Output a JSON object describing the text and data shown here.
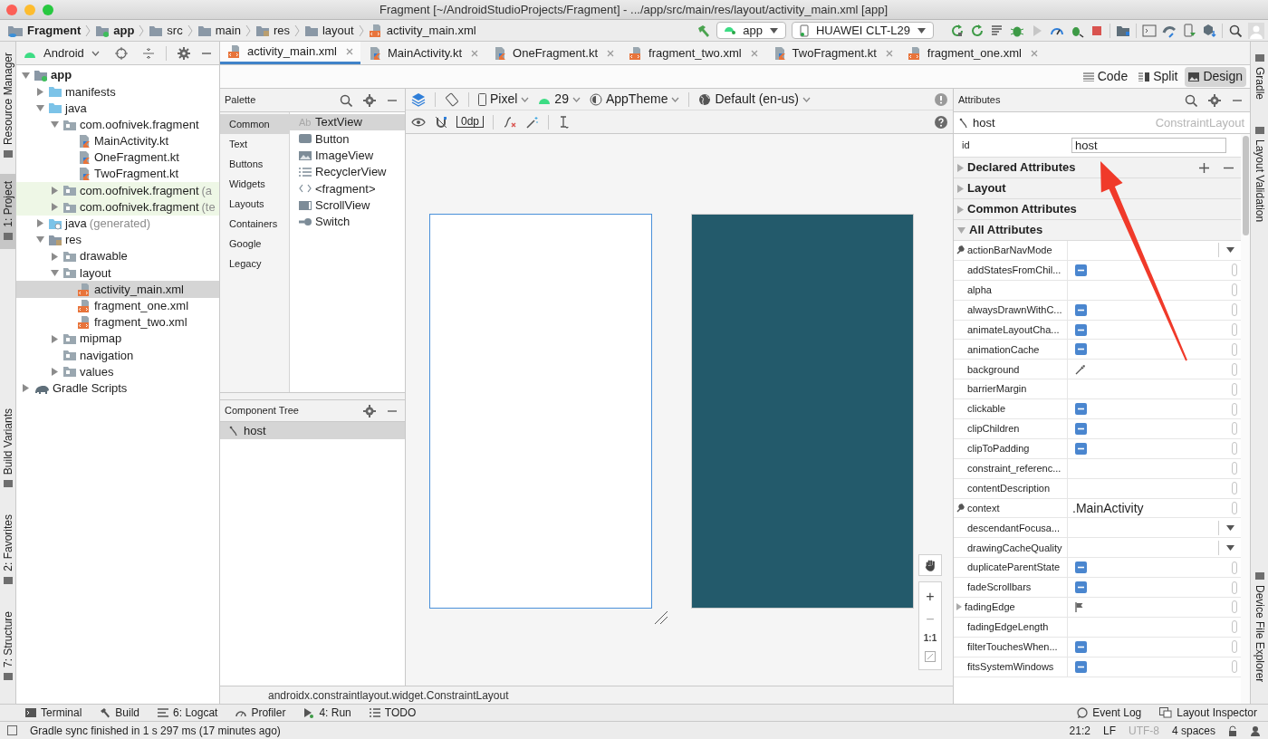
{
  "window": {
    "title": "Fragment [~/AndroidStudioProjects/Fragment] - .../app/src/main/res/layout/activity_main.xml [app]"
  },
  "breadcrumbs": [
    {
      "label": "Fragment",
      "kind": "project"
    },
    {
      "label": "app",
      "kind": "module"
    },
    {
      "label": "src",
      "kind": "folder"
    },
    {
      "label": "main",
      "kind": "folder"
    },
    {
      "label": "res",
      "kind": "res"
    },
    {
      "label": "layout",
      "kind": "folder"
    },
    {
      "label": "activity_main.xml",
      "kind": "xml"
    }
  ],
  "run_config": "app",
  "device": "HUAWEI CLT-L29",
  "left_tool_tabs_top": [
    {
      "label": "Resource Manager",
      "selected": false
    },
    {
      "label": "1: Project",
      "selected": true
    }
  ],
  "left_tool_tabs_bottom": [
    {
      "label": "Build Variants",
      "selected": false
    },
    {
      "label": "2: Favorites",
      "selected": false
    },
    {
      "label": "7: Structure",
      "selected": false
    }
  ],
  "right_tool_tabs_top": [
    {
      "label": "Gradle",
      "selected": false
    },
    {
      "label": "Layout Validation",
      "selected": false
    }
  ],
  "right_tool_tabs_bottom": [
    {
      "label": "Device File Explorer",
      "selected": false
    }
  ],
  "project_view": "Android",
  "project_tree": [
    {
      "label": "app",
      "kind": "module",
      "bold": true,
      "selected": false,
      "expanded": true,
      "children": [
        {
          "label": "manifests",
          "kind": "source-folder",
          "selected": false,
          "expanded": false
        },
        {
          "label": "java",
          "kind": "source-folder",
          "selected": false,
          "expanded": true,
          "children": [
            {
              "label": "com.oofnivek.fragment",
              "kind": "package",
              "selected": false,
              "expanded": true,
              "children": [
                {
                  "label": "MainActivity.kt",
                  "kind": "kotlin",
                  "selected": false
                },
                {
                  "label": "OneFragment.kt",
                  "kind": "kotlin",
                  "selected": false
                },
                {
                  "label": "TwoFragment.kt",
                  "kind": "kotlin",
                  "selected": false
                }
              ]
            },
            {
              "label": "com.oofnivek.fragment",
              "suffix": "(a",
              "kind": "test-package",
              "selected": false,
              "expanded": false
            },
            {
              "label": "com.oofnivek.fragment",
              "suffix": "(te",
              "kind": "test-package",
              "selected": false,
              "expanded": false
            }
          ]
        },
        {
          "label": "java",
          "suffix": "(generated)",
          "kind": "generated-folder",
          "selected": false,
          "expanded": false
        },
        {
          "label": "res",
          "kind": "res",
          "selected": false,
          "expanded": true,
          "children": [
            {
              "label": "drawable",
              "kind": "package",
              "selected": false,
              "expanded": false
            },
            {
              "label": "layout",
              "kind": "package",
              "selected": false,
              "expanded": true,
              "children": [
                {
                  "label": "activity_main.xml",
                  "kind": "xml",
                  "selected": true
                },
                {
                  "label": "fragment_one.xml",
                  "kind": "xml",
                  "selected": false
                },
                {
                  "label": "fragment_two.xml",
                  "kind": "xml",
                  "selected": false
                }
              ]
            },
            {
              "label": "mipmap",
              "kind": "package",
              "selected": false,
              "expanded": false
            },
            {
              "label": "navigation",
              "kind": "package",
              "selected": false
            },
            {
              "label": "values",
              "kind": "package",
              "selected": false,
              "expanded": false
            }
          ]
        }
      ]
    },
    {
      "label": "Gradle Scripts",
      "kind": "gradle",
      "bold": false,
      "selected": false,
      "expanded": false
    }
  ],
  "editor_tabs": [
    {
      "label": "activity_main.xml",
      "kind": "xml",
      "selected": true
    },
    {
      "label": "MainActivity.kt",
      "kind": "kotlin",
      "selected": false
    },
    {
      "label": "OneFragment.kt",
      "kind": "kotlin",
      "selected": false
    },
    {
      "label": "fragment_two.xml",
      "kind": "xml",
      "selected": false
    },
    {
      "label": "TwoFragment.kt",
      "kind": "kotlin",
      "selected": false
    },
    {
      "label": "fragment_one.xml",
      "kind": "xml",
      "selected": false
    }
  ],
  "view_modes": [
    {
      "label": "Code",
      "kind": "code",
      "selected": false
    },
    {
      "label": "Split",
      "kind": "split",
      "selected": false
    },
    {
      "label": "Design",
      "kind": "design",
      "selected": true
    }
  ],
  "palette": {
    "title": "Palette",
    "categories": [
      {
        "label": "Common",
        "selected": true
      },
      {
        "label": "Text",
        "selected": false
      },
      {
        "label": "Buttons",
        "selected": false
      },
      {
        "label": "Widgets",
        "selected": false
      },
      {
        "label": "Layouts",
        "selected": false
      },
      {
        "label": "Containers",
        "selected": false
      },
      {
        "label": "Google",
        "selected": false
      },
      {
        "label": "Legacy",
        "selected": false
      }
    ],
    "items": [
      {
        "label": "TextView",
        "kind": "text",
        "glyph": "Ab",
        "selected": true
      },
      {
        "label": "Button",
        "kind": "button",
        "selected": false
      },
      {
        "label": "ImageView",
        "kind": "image",
        "selected": false
      },
      {
        "label": "RecyclerView",
        "kind": "list",
        "selected": false
      },
      {
        "label": "<fragment>",
        "kind": "fragment",
        "selected": false
      },
      {
        "label": "ScrollView",
        "kind": "scroll",
        "selected": false
      },
      {
        "label": "Switch",
        "kind": "switch",
        "selected": false
      }
    ]
  },
  "component_tree": {
    "title": "Component Tree",
    "items": [
      {
        "label": "host",
        "selected": true
      }
    ]
  },
  "design_toolbar": {
    "device": "Pixel",
    "api": "29",
    "theme": "AppTheme",
    "locale": "Default (en-us)",
    "margin": "0dp"
  },
  "surfaces": [
    {
      "kind": "design",
      "selected": true
    },
    {
      "kind": "blueprint",
      "selected": false
    }
  ],
  "zoom_controls": {
    "zoom_in": "+",
    "zoom_out": "−",
    "actual_size": "1:1"
  },
  "breadcrumb_path": "androidx.constraintlayout.widget.ConstraintLayout",
  "attributes": {
    "title": "Attributes",
    "component": "host",
    "component_class": "ConstraintLayout",
    "id_label": "id",
    "id_value": "host",
    "sections": [
      {
        "label": "Declared Attributes",
        "expanded": false
      },
      {
        "label": "Layout",
        "expanded": false
      },
      {
        "label": "Common Attributes",
        "expanded": false
      },
      {
        "label": "All Attributes",
        "expanded": true
      }
    ],
    "rows": [
      {
        "name": "actionBarNavMode",
        "kind": "dropdown",
        "tools": true
      },
      {
        "name": "addStatesFromChil...",
        "kind": "boolean",
        "tools": false
      },
      {
        "name": "alpha",
        "kind": "text",
        "tools": false
      },
      {
        "name": "alwaysDrawnWithC...",
        "kind": "boolean",
        "tools": false
      },
      {
        "name": "animateLayoutCha...",
        "kind": "boolean",
        "tools": false
      },
      {
        "name": "animationCache",
        "kind": "boolean",
        "tools": false
      },
      {
        "name": "background",
        "kind": "color",
        "tools": false
      },
      {
        "name": "barrierMargin",
        "kind": "text",
        "tools": false
      },
      {
        "name": "clickable",
        "kind": "boolean",
        "tools": false
      },
      {
        "name": "clipChildren",
        "kind": "boolean",
        "tools": false
      },
      {
        "name": "clipToPadding",
        "kind": "boolean",
        "tools": false
      },
      {
        "name": "constraint_referenc...",
        "kind": "text",
        "tools": false
      },
      {
        "name": "contentDescription",
        "kind": "text",
        "tools": false
      },
      {
        "name": "context",
        "kind": "text",
        "tools": true,
        "value": ".MainActivity"
      },
      {
        "name": "descendantFocusa...",
        "kind": "dropdown",
        "tools": false
      },
      {
        "name": "drawingCacheQuality",
        "kind": "dropdown",
        "tools": false
      },
      {
        "name": "duplicateParentState",
        "kind": "boolean",
        "tools": false
      },
      {
        "name": "fadeScrollbars",
        "kind": "boolean",
        "tools": false
      },
      {
        "name": "fadingEdge",
        "kind": "flags",
        "tools": false
      },
      {
        "name": "fadingEdgeLength",
        "kind": "text",
        "tools": false
      },
      {
        "name": "filterTouchesWhen...",
        "kind": "boolean",
        "tools": false
      },
      {
        "name": "fitsSystemWindows",
        "kind": "boolean",
        "tools": false
      }
    ]
  },
  "bottom_tools_left": [
    {
      "label": "Terminal",
      "kind": "terminal"
    },
    {
      "label": "Build",
      "kind": "build"
    },
    {
      "label": "6: Logcat",
      "kind": "logcat"
    },
    {
      "label": "Profiler",
      "kind": "profiler"
    },
    {
      "label": "4: Run",
      "kind": "run"
    },
    {
      "label": "TODO",
      "kind": "todo"
    }
  ],
  "bottom_tools_right": [
    {
      "label": "Event Log",
      "kind": "log"
    },
    {
      "label": "Layout Inspector",
      "kind": "inspector"
    }
  ],
  "status_bar": {
    "message": "Gradle sync finished in 1 s 297 ms (17 minutes ago)",
    "position": "21:2",
    "line_separator": "LF",
    "encoding": "UTF-8",
    "encoding_disabled": true,
    "indent": "4 spaces"
  }
}
